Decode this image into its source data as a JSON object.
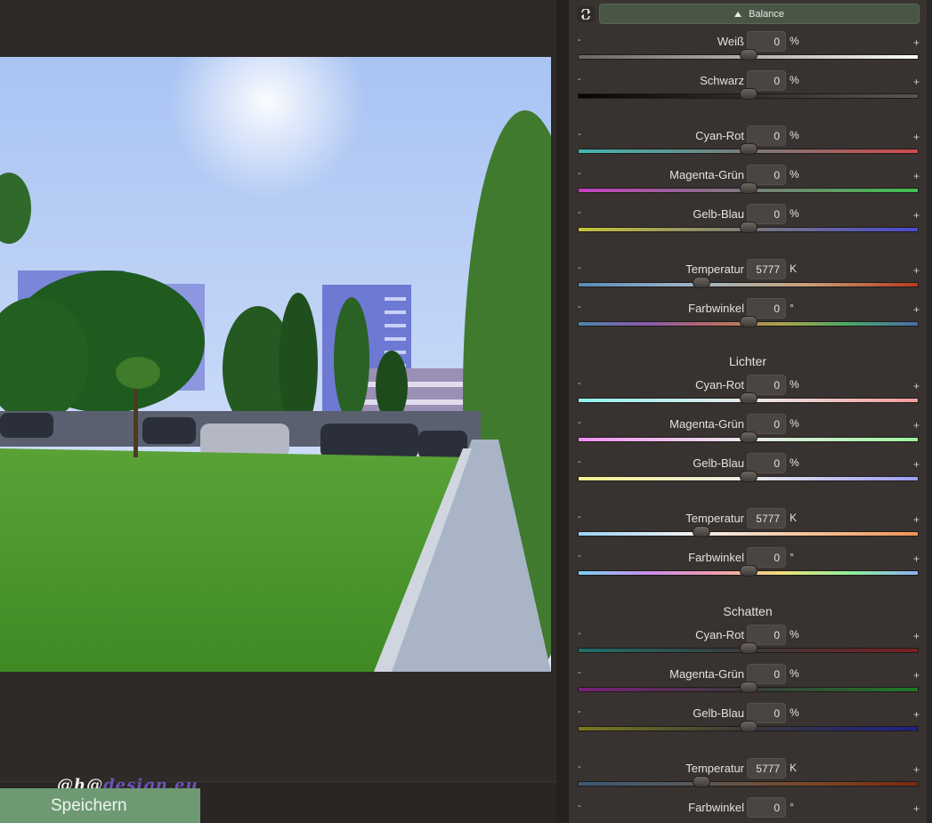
{
  "header": {
    "title": "Balance"
  },
  "save_button": {
    "label": "Speichern"
  },
  "watermark": {
    "part1": "@h@",
    "part2": "design.eu"
  },
  "units": {
    "percent": "%",
    "kelvin": "K",
    "degree": "°"
  },
  "slider_signs": {
    "minus": "-",
    "plus": "+"
  },
  "general": {
    "weiss": {
      "label": "Weiß",
      "value": "0",
      "unit": "%"
    },
    "schwarz": {
      "label": "Schwarz",
      "value": "0",
      "unit": "%"
    },
    "cyan_rot": {
      "label": "Cyan-Rot",
      "value": "0",
      "unit": "%"
    },
    "magenta_gruen": {
      "label": "Magenta-Grün",
      "value": "0",
      "unit": "%"
    },
    "gelb_blau": {
      "label": "Gelb-Blau",
      "value": "0",
      "unit": "%"
    },
    "temperatur": {
      "label": "Temperatur",
      "value": "5777",
      "unit": "K"
    },
    "farbwinkel": {
      "label": "Farbwinkel",
      "value": "0",
      "unit": "°"
    }
  },
  "lichter": {
    "title": "Lichter",
    "cyan_rot": {
      "label": "Cyan-Rot",
      "value": "0",
      "unit": "%"
    },
    "magenta_gruen": {
      "label": "Magenta-Grün",
      "value": "0",
      "unit": "%"
    },
    "gelb_blau": {
      "label": "Gelb-Blau",
      "value": "0",
      "unit": "%"
    },
    "temperatur": {
      "label": "Temperatur",
      "value": "5777",
      "unit": "K"
    },
    "farbwinkel": {
      "label": "Farbwinkel",
      "value": "0",
      "unit": "°"
    }
  },
  "schatten": {
    "title": "Schatten",
    "cyan_rot": {
      "label": "Cyan-Rot",
      "value": "0",
      "unit": "%"
    },
    "magenta_gruen": {
      "label": "Magenta-Grün",
      "value": "0",
      "unit": "%"
    },
    "gelb_blau": {
      "label": "Gelb-Blau",
      "value": "0",
      "unit": "%"
    },
    "temperatur": {
      "label": "Temperatur",
      "value": "5777",
      "unit": "K"
    },
    "farbwinkel": {
      "label": "Farbwinkel",
      "value": "0",
      "unit": "°"
    }
  },
  "colors": {
    "accent_green": "#6e9a73",
    "header_green": "#4a5645",
    "panel_bg": "#383330"
  }
}
